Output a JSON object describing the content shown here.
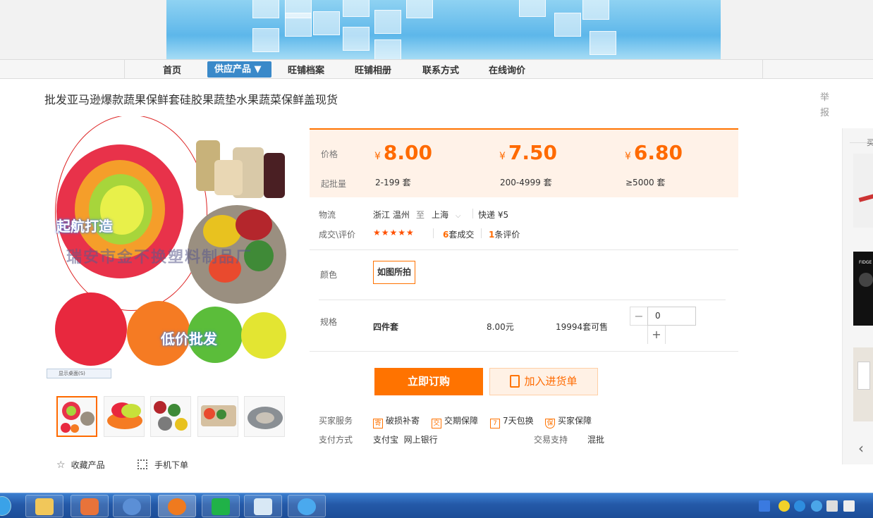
{
  "nav": {
    "items": [
      "首页",
      "供应产品 ▼",
      "旺铺档案",
      "旺铺相册",
      "联系方式",
      "在线询价"
    ]
  },
  "product": {
    "title": "批发亚马逊爆款蔬果保鲜套硅胶果蔬垫水果蔬菜保鲜盖现货",
    "report": "举报",
    "image_text": {
      "tag1": "起航打造",
      "watermark": "瑞安市金不换塑料制品厂",
      "tag2": "低价批发",
      "caption": "显示桌面(S)"
    }
  },
  "pricing": {
    "price_label": "价格",
    "moq_label": "起批量",
    "currency": "¥",
    "tiers": [
      {
        "price": "8.00",
        "qty": "2-199 套"
      },
      {
        "price": "7.50",
        "qty": "200-4999 套"
      },
      {
        "price": "6.80",
        "qty": "≥5000 套"
      }
    ]
  },
  "logistics": {
    "label": "物流",
    "from": "浙江 温州",
    "to_word": "至",
    "to": "上海",
    "express": "快递 ¥5"
  },
  "deals": {
    "label": "成交\\评价",
    "stars": "★★★★★",
    "rating": 5,
    "sold_count": "6",
    "sold_suffix": "套成交",
    "review_count": "1",
    "review_suffix": "条评价"
  },
  "color": {
    "label": "颜色",
    "option": "如图所拍"
  },
  "spec": {
    "label": "规格",
    "name": "四件套",
    "price": "8.00元",
    "stock": "19994套可售",
    "minus": "−",
    "plus": "+",
    "quantity": "0"
  },
  "buttons": {
    "order": "立即订购",
    "cart": "加入进货单"
  },
  "services": {
    "label": "买家服务",
    "items": [
      {
        "icon": "寄",
        "text": "破损补寄"
      },
      {
        "icon": "交",
        "text": "交期保障"
      },
      {
        "icon": "7",
        "text": "7天包换"
      },
      {
        "icon": "保",
        "text": "买家保障"
      }
    ]
  },
  "payment": {
    "label": "支付方式",
    "methods": "支付宝  网上银行",
    "trade_label": "交易支持",
    "trade_value": "混批"
  },
  "links": {
    "favorite": "收藏产品",
    "mobile": "手机下单"
  },
  "sidebar": {
    "header": "买",
    "brand_text": "FIDGE",
    "arrow": "‹"
  },
  "colors": {
    "accent": "#ff6a00",
    "nav_active": "#3a89c9",
    "price_bg": "#fff2e8"
  }
}
